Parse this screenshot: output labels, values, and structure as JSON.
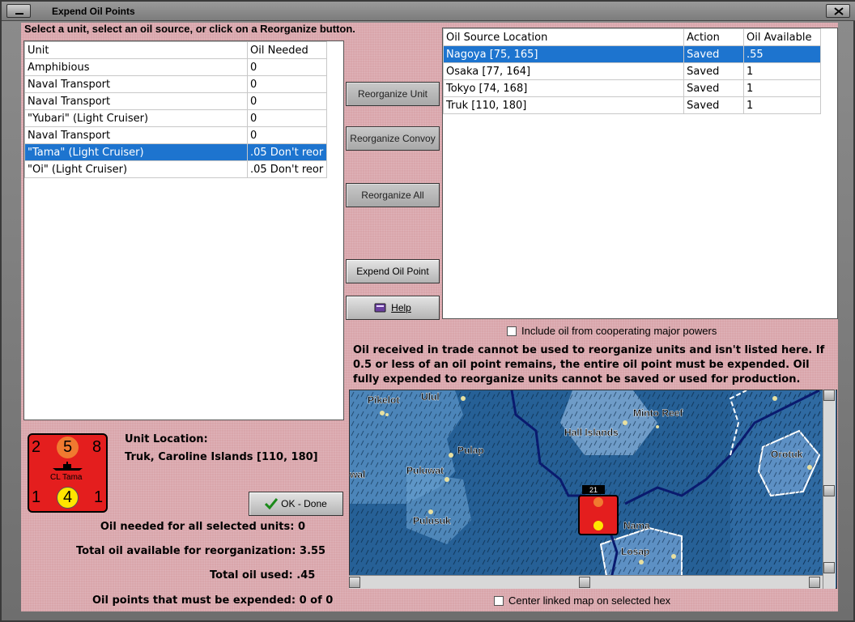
{
  "window": {
    "title": "Expend Oil Points"
  },
  "instruction": "Select a unit, select an oil source, or click on a Reorganize button.",
  "units_table": {
    "headers": [
      "Unit",
      "Oil Needed"
    ],
    "rows": [
      [
        "Amphibious",
        "0"
      ],
      [
        "Naval Transport",
        "0"
      ],
      [
        "Naval Transport",
        "0"
      ],
      [
        "\"Yubari\" (Light Cruiser)",
        "0"
      ],
      [
        "Naval Transport",
        "0"
      ],
      [
        "\"Tama\" (Light Cruiser)",
        ".05 Don't reor"
      ],
      [
        "\"Oi\" (Light Cruiser)",
        ".05 Don't reor"
      ]
    ],
    "selected_index": 5
  },
  "oil_table": {
    "headers": [
      "Oil Source Location",
      "Action",
      "Oil Available"
    ],
    "rows": [
      [
        "Nagoya [75, 165]",
        "Saved",
        ".55"
      ],
      [
        "Osaka [77, 164]",
        "Saved",
        "1"
      ],
      [
        "Tokyo [74, 168]",
        "Saved",
        "1"
      ],
      [
        "Truk [110, 180]",
        "Saved",
        "1"
      ]
    ],
    "selected_index": 0
  },
  "buttons": {
    "reorganize_unit": "Reorganize Unit",
    "reorganize_convoy": "Reorganize Convoy",
    "reorganize_all": "Reorganize All",
    "expend_oil_point": "Expend Oil Point",
    "help": "Help",
    "ok_done": "OK - Done"
  },
  "include_oil_label": "Include oil from cooperating major powers",
  "note": "Oil received in trade cannot be used to reorganize units and isn't listed here.  If 0.5 or less of an oil point remains, the entire oil point must be expended.   Oil fully expended to reorganize units cannot be saved or used for production.",
  "unit_counter": {
    "top_left": "2",
    "top_mid": "5",
    "top_right": "8",
    "name": "CL Tama",
    "bottom_left": "1",
    "bottom_mid": "4",
    "bottom_right": "1"
  },
  "unit_location": {
    "label": "Unit Location:",
    "value": "Truk, Caroline Islands [110, 180]"
  },
  "stats": [
    {
      "label": "Oil needed for all selected units:",
      "value": "0"
    },
    {
      "label": "Total oil available for reorganization:",
      "value": "3.55"
    },
    {
      "label": "Total oil used:",
      "value": ".45"
    },
    {
      "label": "Oil points that must be expended:",
      "value": "0 of 0"
    }
  ],
  "map": {
    "labels": [
      "Pikelot",
      "Ulul",
      "Minto Reef",
      "Hall Islands",
      "Pulap",
      "Puluwat",
      "wal",
      "Orotuk",
      "Pulusuk",
      "Nama",
      "Losap"
    ],
    "stack_count": "21"
  },
  "center_map_label": "Center linked map on selected hex"
}
